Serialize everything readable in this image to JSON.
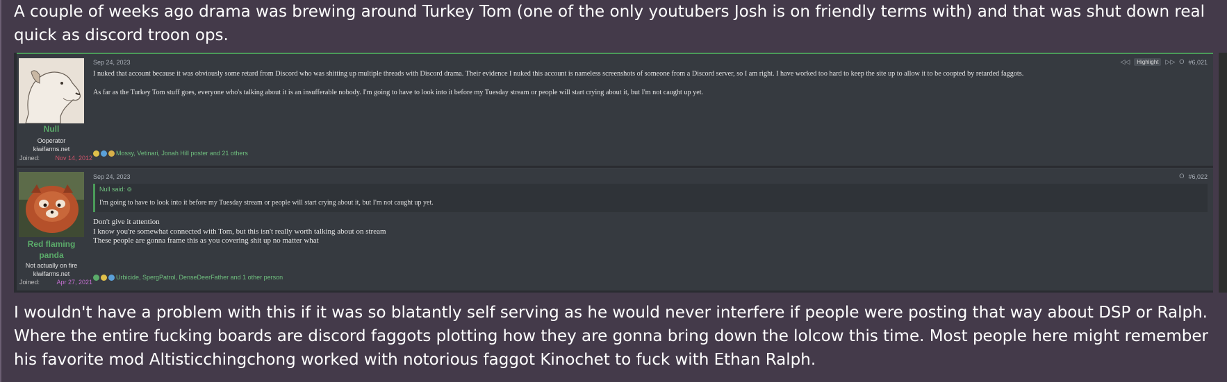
{
  "paragraphs": {
    "top": "A couple of weeks ago drama was brewing around Turkey Tom (one of the only youtubers Josh is on friendly terms with) and that was shut down real quick as discord troon ops.",
    "bottom": "I wouldn't have a problem with this if it was so blatantly self serving as he would never interfere if people were posting that way about DSP or Ralph. Where the entire fucking boards are discord faggots plotting how they are gonna bring down the lolcow this time. Most people here might remember his favorite mod Altisticchingchong worked with notorious faggot Kinochet to fuck with Ethan Ralph."
  },
  "posts": [
    {
      "user": {
        "name": "Null",
        "title": "Ooperator",
        "site": "kiwifarms.net",
        "joined_label": "Joined:",
        "joined_date": "Nov 14, 2012"
      },
      "date": "Sep 24, 2023",
      "highlight_label": "Highlight",
      "post_number": "#6,021",
      "lines": [
        "I nuked that account because it was obviously some retard from Discord who was shitting up multiple threads with Discord drama. Their evidence I nuked this account is nameless screenshots of someone from a Discord server, so I am right. I have worked too hard to keep the site up to allow it to be coopted by retarded faggots.",
        "As far as the Turkey Tom stuff goes, everyone who's talking about it is an insufferable nobody. I'm going to have to look into it before my Tuesday stream or people will start crying about it, but I'm not caught up yet."
      ],
      "reactions": "Mossy, Vetinari, Jonah Hill poster and 21 others"
    },
    {
      "user": {
        "name": "Red flaming panda",
        "title": "Not actually on fire",
        "site": "kiwifarms.net",
        "joined_label": "Joined:",
        "joined_date": "Apr 27, 2021"
      },
      "date": "Sep 24, 2023",
      "post_number": "#6,022",
      "quote": {
        "head": "Null said:",
        "text": "I'm going to have to look into it before my Tuesday stream or people will start crying about it, but I'm not caught up yet."
      },
      "lines": [
        "Don't give it attention",
        "I know you're somewhat connected with Tom, but this isn't really worth talking about on stream",
        "These people are gonna frame this as you covering shit up no matter what"
      ],
      "reactions": "Urbicide, SpergPatrol, DenseDeerFather and 1 other person"
    }
  ],
  "icons": {
    "share": "share-icon",
    "prev": "prev-icon",
    "next": "next-icon",
    "quote_arrow": "up-arrow-icon"
  },
  "colors": {
    "background": "#443a4a",
    "post_bg": "#363a40",
    "accent_green": "#4a9a59",
    "username": "#5bab6a"
  }
}
